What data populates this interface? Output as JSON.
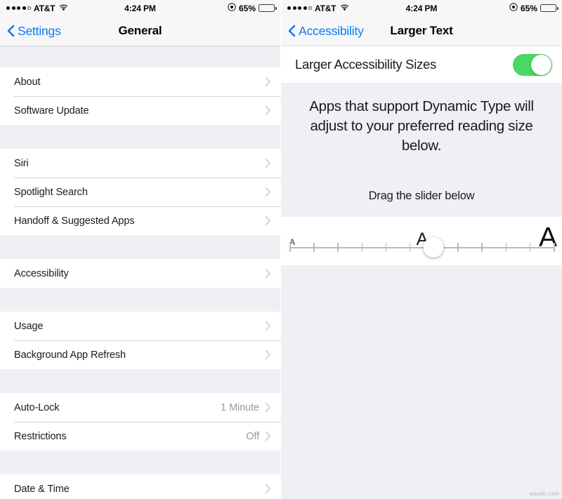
{
  "status_bar": {
    "carrier": "AT&T",
    "signal_dots_filled": 4,
    "signal_dots_total": 5,
    "wifi_icon": "wifi-icon",
    "time": "4:24 PM",
    "rotation_lock_icon": "rotation-lock-icon",
    "battery_percent": "65%",
    "battery_level": 65
  },
  "left_screen": {
    "nav": {
      "back_label": "Settings",
      "back_icon": "chevron-left-icon",
      "title": "General"
    },
    "groups": [
      {
        "rows": [
          {
            "label": "About",
            "value": "",
            "accessory": "chevron-right-icon"
          },
          {
            "label": "Software Update",
            "value": "",
            "accessory": "chevron-right-icon"
          }
        ]
      },
      {
        "rows": [
          {
            "label": "Siri",
            "value": "",
            "accessory": "chevron-right-icon"
          },
          {
            "label": "Spotlight Search",
            "value": "",
            "accessory": "chevron-right-icon"
          },
          {
            "label": "Handoff & Suggested Apps",
            "value": "",
            "accessory": "chevron-right-icon"
          }
        ]
      },
      {
        "rows": [
          {
            "label": "Accessibility",
            "value": "",
            "accessory": "chevron-right-icon"
          }
        ]
      },
      {
        "rows": [
          {
            "label": "Usage",
            "value": "",
            "accessory": "chevron-right-icon"
          },
          {
            "label": "Background App Refresh",
            "value": "",
            "accessory": "chevron-right-icon"
          }
        ]
      },
      {
        "rows": [
          {
            "label": "Auto-Lock",
            "value": "1 Minute",
            "accessory": "chevron-right-icon"
          },
          {
            "label": "Restrictions",
            "value": "Off",
            "accessory": "chevron-right-icon"
          }
        ]
      },
      {
        "rows": [
          {
            "label": "Date & Time",
            "value": "",
            "accessory": "chevron-right-icon"
          }
        ]
      }
    ]
  },
  "right_screen": {
    "nav": {
      "back_label": "Accessibility",
      "back_icon": "chevron-left-icon",
      "title": "Larger Text"
    },
    "toggle": {
      "label": "Larger Accessibility Sizes",
      "state": "on",
      "on_color": "#4ad863"
    },
    "description": "Apps that support Dynamic Type will adjust to your preferred reading size below.",
    "drag_hint": "Drag the slider below",
    "slider": {
      "min_label": "A",
      "current_label": "A",
      "max_label": "A",
      "ticks": 12,
      "value_index": 6,
      "accessory": "slider-knob"
    }
  },
  "watermark": "wsxdn.com",
  "colors": {
    "accent_blue": "#0a7bf3",
    "group_bg": "#eff0f4",
    "row_bg": "#ffffff",
    "separator": "#d2d2d6",
    "value_gray": "#9a9a9f"
  }
}
